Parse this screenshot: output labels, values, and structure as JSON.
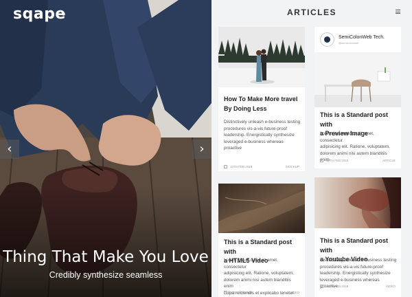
{
  "hero": {
    "logo": "sqape",
    "title": "Thing That Make You Love",
    "subtitle": "Credibly synthesize seamless",
    "prev_arrow": "‹",
    "next_arrow": "›"
  },
  "panel": {
    "title": "ARTICLES"
  },
  "cards": [
    {
      "title_lines": [
        "How To Make More travel",
        "By Doing Less"
      ],
      "excerpt_lines": [
        "Distinctively unleash e-business testing",
        "procedures vis-a-vis future-proof",
        "leadership. Energistically synthesize",
        "leveraged e-business whereas proactive"
      ],
      "date": "10TH FEB 2018",
      "category": "MOCKUP"
    },
    {
      "author_name": "SemiColonWeb Tech.",
      "author_handle": "@semicolonweb",
      "title_lines": [
        "This is a Standard post with",
        "a Preview Image"
      ],
      "excerpt_lines": [
        "Lorem ipsum dolor sit amet, consectetur",
        "adipisicing elit. Ratione, voluptatem,",
        "dolorem animi nisi autem blanditiis enim"
      ],
      "date": "10TH FEB 2018",
      "category": "ARTICLE"
    },
    {
      "title_lines": [
        "This is a Standard post with",
        "a HTML5 Video"
      ],
      "excerpt_lines": [
        "Lorem ipsum dolor sit amet, consectetur",
        "adipisicing elit. Ratione, voluptatem,",
        "dolorem animi nisi autem blanditiis enim",
        "culpa reiciendis et explicabo tenetur."
      ],
      "date": "10TH FEB 2018",
      "category": "VIDEO"
    },
    {
      "title_lines": [
        "This is a Standard post with",
        "a Youtube Video"
      ],
      "excerpt_lines": [
        "Distinctively unleash e-business testing",
        "procedures vis-a-vis future-proof",
        "leadership. Energistically synthesize",
        "leveraged e-business whereas proactive"
      ],
      "date": "10TH FEB 2018",
      "category": "VIDEO"
    }
  ],
  "colors": {
    "panel_bg": "#f2f3f5",
    "card_bg": "#ffffff",
    "text_dark": "#222222",
    "text_body": "#555555"
  }
}
